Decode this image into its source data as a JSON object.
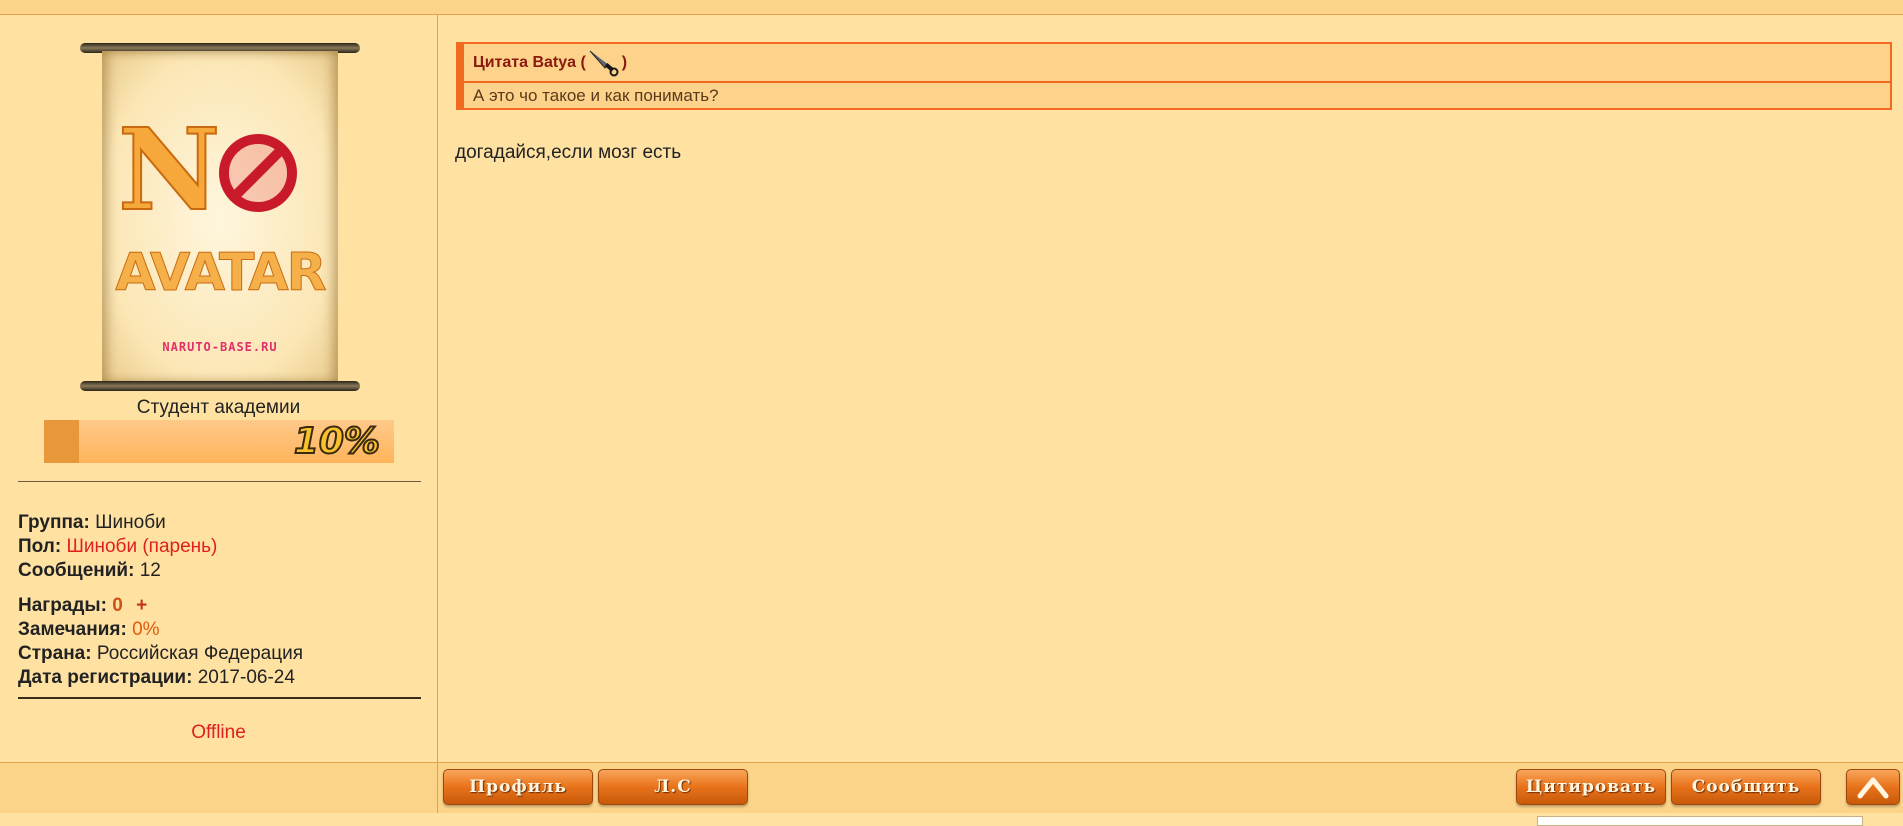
{
  "user": {
    "rank_title": "Студент академии",
    "rank_progress_label": "10%",
    "rank_progress": 0.1,
    "avatar": {
      "main_text_n": "N",
      "main_text_word": "AVATAR",
      "site_text": "NARUTO-BASE.RU"
    },
    "info": {
      "group_label": "Группа:",
      "group_value": "Шиноби",
      "gender_label": "Пол:",
      "gender_value": "Шиноби (парень)",
      "posts_label": "Сообщений:",
      "posts_value": "12",
      "awards_label": "Награды:",
      "awards_value": "0",
      "awards_plus": "+",
      "warnings_label": "Замечания:",
      "warnings_value": "0%",
      "country_label": "Страна:",
      "country_value": "Российская Федерация",
      "reg_label": "Дата регистрации:",
      "reg_value": "2017-06-24"
    },
    "status": "Offline"
  },
  "post": {
    "quote": {
      "header_prefix": "Цитата Batya (",
      "header_suffix": ")",
      "icon": "kunai-icon",
      "text": "А это чо такое и как понимать?"
    },
    "body": "догадайся,если мозг есть"
  },
  "buttons": {
    "profile": "Профиль",
    "pm": "Л.С",
    "quote": "Цитировать",
    "report": "Сообщить",
    "up_icon": "arrow-up-icon"
  },
  "colors": {
    "background": "#ffe2a2",
    "bar": "#fcd489",
    "accent": "#f06a20",
    "status_offline": "#e02020"
  }
}
